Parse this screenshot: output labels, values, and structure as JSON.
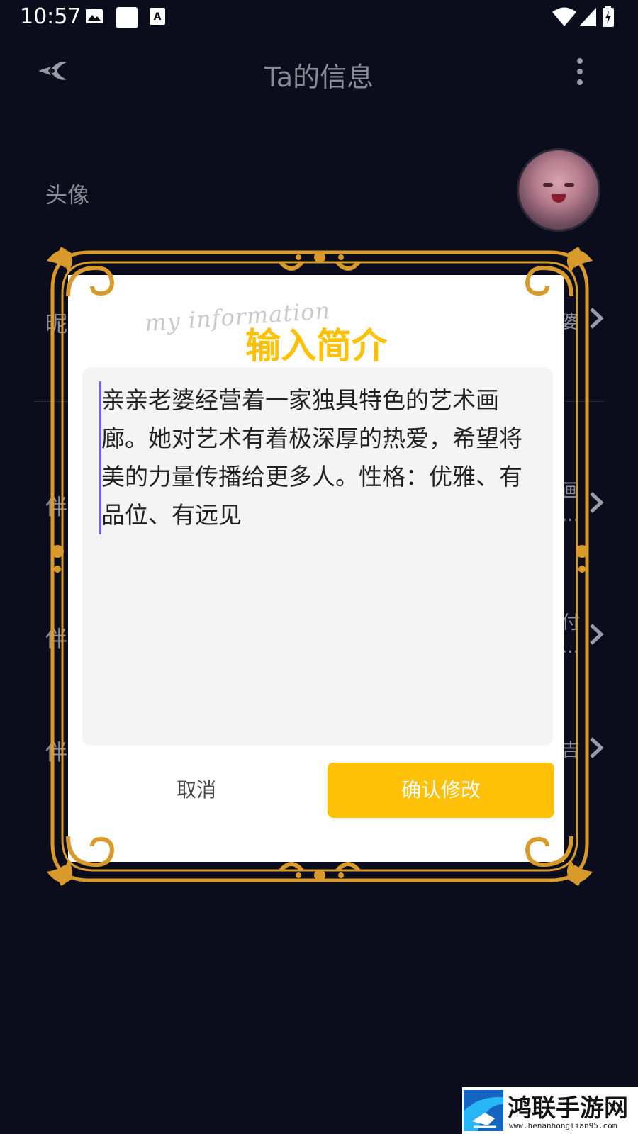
{
  "status_bar": {
    "time": "10:57"
  },
  "app_bar": {
    "title": "Ta的信息"
  },
  "list": {
    "avatar_label": "头像",
    "nickname_label_partial": "昵",
    "nickname_value_partial": "婆",
    "row2_label_partial": "伴",
    "row2_value_partial": "画",
    "row2_ellipsis": "...",
    "row3_label_partial": "伴",
    "row3_value_partial": "付",
    "row3_ellipsis": "...",
    "row4_label_partial": "伴",
    "row4_value_partial": "吉"
  },
  "dialog": {
    "script_text": "my information",
    "title": "输入简介",
    "text_value": "亲亲老婆经营着一家独具特色的艺术画廊。她对艺术有着极深厚的热爱，希望将美的力量传播给更多人。性格：优雅、有品位、有远见",
    "cancel_label": "取消",
    "confirm_label": "确认修改",
    "accent_color": "#ffc107",
    "frame_color": "#d89a2a"
  },
  "watermark": {
    "name": "鸿联手游网",
    "url": "www.henanhonglian95.com"
  }
}
